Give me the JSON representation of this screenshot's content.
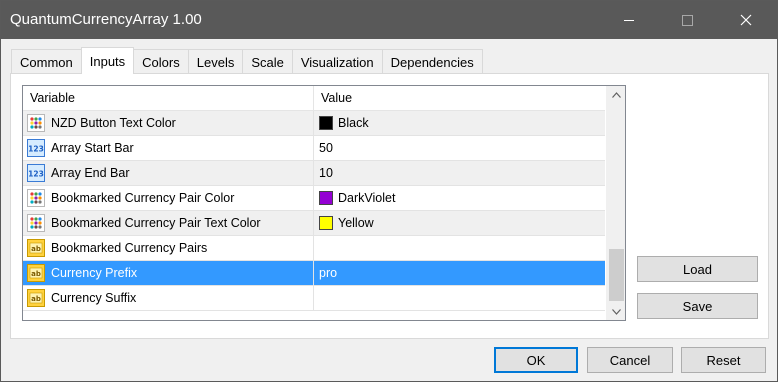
{
  "window": {
    "title": "QuantumCurrencyArray 1.00"
  },
  "tabs": [
    {
      "label": "Common"
    },
    {
      "label": "Inputs"
    },
    {
      "label": "Colors"
    },
    {
      "label": "Levels"
    },
    {
      "label": "Scale"
    },
    {
      "label": "Visualization"
    },
    {
      "label": "Dependencies"
    }
  ],
  "active_tab": "Inputs",
  "grid": {
    "header": {
      "variable": "Variable",
      "value": "Value"
    },
    "rows": [
      {
        "type": "color",
        "icon": "color-param-icon",
        "variable": "NZD Button Text Color",
        "value": "Black",
        "swatch": "#000000"
      },
      {
        "type": "int",
        "icon": "integer-param-icon",
        "variable": "Array Start Bar",
        "value": "50"
      },
      {
        "type": "int",
        "icon": "integer-param-icon",
        "variable": "Array End Bar",
        "value": "10"
      },
      {
        "type": "color",
        "icon": "color-param-icon",
        "variable": "Bookmarked Currency Pair Color",
        "value": "DarkViolet",
        "swatch": "#9400d3"
      },
      {
        "type": "color",
        "icon": "color-param-icon",
        "variable": "Bookmarked Currency Pair Text Color",
        "value": "Yellow",
        "swatch": "#ffff00"
      },
      {
        "type": "string",
        "icon": "string-param-icon",
        "variable": "Bookmarked Currency Pairs",
        "value": ""
      },
      {
        "type": "string",
        "icon": "string-param-icon",
        "variable": "Currency Prefix",
        "value": "pro",
        "selected": true
      },
      {
        "type": "string",
        "icon": "string-param-icon",
        "variable": "Currency Suffix",
        "value": ""
      }
    ]
  },
  "side_buttons": {
    "load": "Load",
    "save": "Save"
  },
  "footer_buttons": {
    "ok": "OK",
    "cancel": "Cancel",
    "reset": "Reset"
  },
  "colors": {
    "selection": "#3399ff",
    "titlebar": "#595959"
  }
}
